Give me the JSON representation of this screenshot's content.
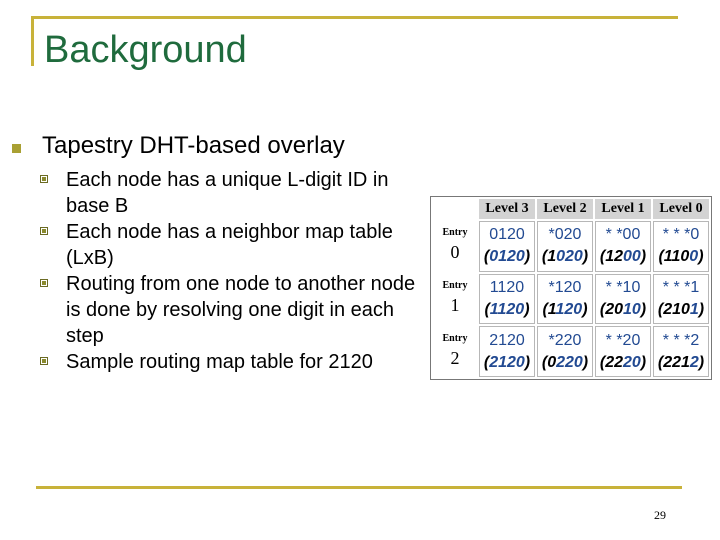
{
  "slide": {
    "title": "Background",
    "page_number": "29",
    "bullet": "Tapestry DHT-based overlay",
    "subbullets": [
      "Each node has a unique L-digit ID in base B",
      "Each node has a neighbor map table (LxB)",
      "Routing from one node to another node is done by resolving one digit in each step",
      "Sample routing map table for 2120"
    ]
  },
  "routing_table": {
    "headers": [
      "Level 3",
      "Level 2",
      "Level 1",
      "Level 0"
    ],
    "entry_label": "Entry",
    "rows": [
      {
        "entry": "0",
        "patterns": [
          "0120",
          "*020",
          "* *00",
          "* * *0"
        ],
        "matches": [
          {
            "black": "",
            "blue": "0120"
          },
          {
            "black": "1",
            "blue": "020"
          },
          {
            "black": "12",
            "blue": "00"
          },
          {
            "black": "110",
            "blue": "0"
          }
        ]
      },
      {
        "entry": "1",
        "patterns": [
          "1120",
          "*120",
          "* *10",
          "* * *1"
        ],
        "matches": [
          {
            "black": "",
            "blue": "1120"
          },
          {
            "black": "1",
            "blue": "120"
          },
          {
            "black": "20",
            "blue": "10"
          },
          {
            "black": "210",
            "blue": "1"
          }
        ]
      },
      {
        "entry": "2",
        "patterns": [
          "2120",
          "*220",
          "* *20",
          "* * *2"
        ],
        "matches": [
          {
            "black": "",
            "blue": "2120"
          },
          {
            "black": "0",
            "blue": "220"
          },
          {
            "black": "22",
            "blue": "20"
          },
          {
            "black": "221",
            "blue": "2"
          }
        ]
      }
    ],
    "colors": {
      "pattern_text": "#224a92",
      "header_bg": "#d3d3d3"
    }
  }
}
